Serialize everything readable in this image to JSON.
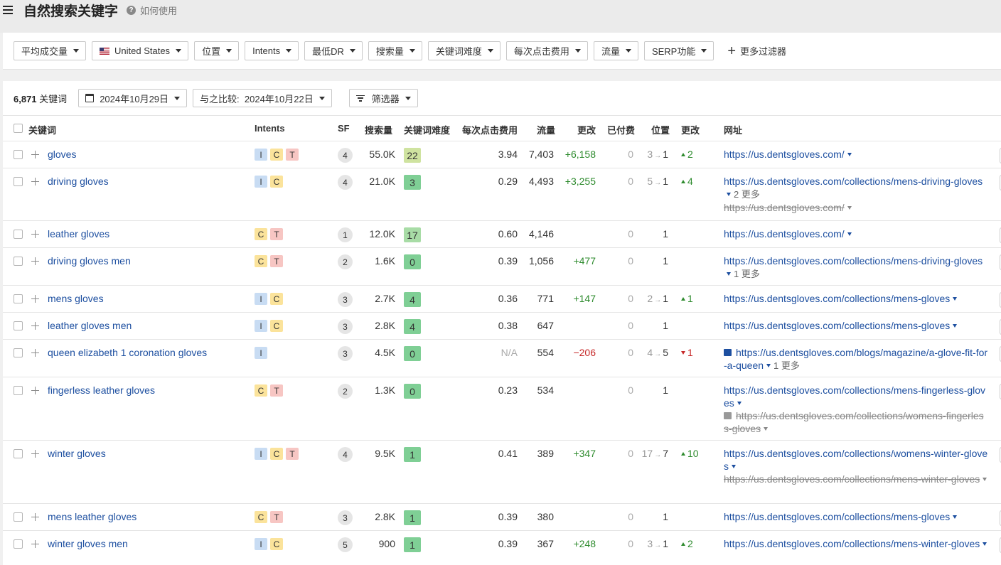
{
  "header": {
    "title": "自然搜索关键字",
    "help_label": "如何使用"
  },
  "filters": [
    "平均成交量",
    "United States",
    "位置",
    "Intents",
    "最低DR",
    "搜索量",
    "关键词难度",
    "每次点击费用",
    "流量",
    "SERP功能"
  ],
  "more_filters": "更多过滤器",
  "toolbar": {
    "count": "6,871",
    "count_label": "关键词",
    "date": "2024年10月29日",
    "compare_label": "与之比较:",
    "compare_date": "2024年10月22日",
    "filter_btn": "筛选器"
  },
  "columns": {
    "keyword": "关键词",
    "intents": "Intents",
    "sf": "SF",
    "volume": "搜索量",
    "kd": "关键词难度",
    "cpc": "每次点击费用",
    "traffic": "流量",
    "change": "更改",
    "paid": "已付费",
    "position": "位置",
    "pos_change": "更改",
    "url": "网址"
  },
  "rows": [
    {
      "keyword": "gloves",
      "intents": [
        "I",
        "C",
        "T"
      ],
      "sf": "4",
      "volume": "55.0K",
      "kd": "22",
      "kd_color": "#cfe3a0",
      "cpc": "3.94",
      "traffic": "7,403",
      "change": "+6,158",
      "paid": "0",
      "pos_from": "3",
      "pos_to": "1",
      "pos_change": "2",
      "pos_dir": "up",
      "url": "https://us.dentsgloves.com/",
      "url_more": "",
      "old_url": "",
      "url_image": false,
      "old_image": false
    },
    {
      "keyword": "driving gloves",
      "intents": [
        "I",
        "C"
      ],
      "sf": "4",
      "volume": "21.0K",
      "kd": "3",
      "kd_color": "#7fcf95",
      "cpc": "0.29",
      "traffic": "4,493",
      "change": "+3,255",
      "paid": "0",
      "pos_from": "5",
      "pos_to": "1",
      "pos_change": "4",
      "pos_dir": "up",
      "url": "https://us.dentsgloves.com/collections/mens-driving-gloves",
      "url_more": "2 更多",
      "old_url": "https://us.dentsgloves.com/",
      "url_image": false,
      "old_image": false
    },
    {
      "keyword": "leather gloves",
      "intents": [
        "C",
        "T"
      ],
      "sf": "1",
      "volume": "12.0K",
      "kd": "17",
      "kd_color": "#a8dca6",
      "cpc": "0.60",
      "traffic": "4,146",
      "change": "",
      "paid": "0",
      "pos_from": "",
      "pos_to": "1",
      "pos_change": "",
      "pos_dir": "",
      "url": "https://us.dentsgloves.com/",
      "url_more": "",
      "old_url": "",
      "url_image": false,
      "old_image": false
    },
    {
      "keyword": "driving gloves men",
      "intents": [
        "C",
        "T"
      ],
      "sf": "2",
      "volume": "1.6K",
      "kd": "0",
      "kd_color": "#7fcf95",
      "cpc": "0.39",
      "traffic": "1,056",
      "change": "+477",
      "paid": "0",
      "pos_from": "",
      "pos_to": "1",
      "pos_change": "",
      "pos_dir": "",
      "url": "https://us.dentsgloves.com/collections/mens-driving-gloves",
      "url_more": "1 更多",
      "old_url": "",
      "url_image": false,
      "old_image": false
    },
    {
      "keyword": "mens gloves",
      "intents": [
        "I",
        "C"
      ],
      "sf": "3",
      "volume": "2.7K",
      "kd": "4",
      "kd_color": "#7fcf95",
      "cpc": "0.36",
      "traffic": "771",
      "change": "+147",
      "paid": "0",
      "pos_from": "2",
      "pos_to": "1",
      "pos_change": "1",
      "pos_dir": "up",
      "url": "https://us.dentsgloves.com/collections/mens-gloves",
      "url_more": "",
      "old_url": "",
      "url_image": false,
      "old_image": false
    },
    {
      "keyword": "leather gloves men",
      "intents": [
        "I",
        "C"
      ],
      "sf": "3",
      "volume": "2.8K",
      "kd": "4",
      "kd_color": "#7fcf95",
      "cpc": "0.38",
      "traffic": "647",
      "change": "",
      "paid": "0",
      "pos_from": "",
      "pos_to": "1",
      "pos_change": "",
      "pos_dir": "",
      "url": "https://us.dentsgloves.com/collections/mens-gloves",
      "url_more": "",
      "old_url": "",
      "url_image": false,
      "old_image": false
    },
    {
      "keyword": "queen elizabeth 1 coronation gloves",
      "intents": [
        "I"
      ],
      "sf": "3",
      "volume": "4.5K",
      "kd": "0",
      "kd_color": "#7fcf95",
      "cpc": "N/A",
      "traffic": "554",
      "change": "−206",
      "paid": "0",
      "pos_from": "4",
      "pos_to": "5",
      "pos_change": "1",
      "pos_dir": "down",
      "url": "https://us.dentsgloves.com/blogs/magazine/a-glove-fit-for-a-queen",
      "url_more": "1 更多",
      "old_url": "",
      "url_image": true,
      "old_image": false
    },
    {
      "keyword": "fingerless leather gloves",
      "intents": [
        "C",
        "T"
      ],
      "sf": "2",
      "volume": "1.3K",
      "kd": "0",
      "kd_color": "#7fcf95",
      "cpc": "0.23",
      "traffic": "534",
      "change": "",
      "paid": "0",
      "pos_from": "",
      "pos_to": "1",
      "pos_change": "",
      "pos_dir": "",
      "url": "https://us.dentsgloves.com/collections/mens-fingerless-gloves",
      "url_more": "",
      "old_url": "https://us.dentsgloves.com/collections/womens-fingerless-gloves",
      "url_image": false,
      "old_image": true
    },
    {
      "keyword": "winter gloves",
      "intents": [
        "I",
        "C",
        "T"
      ],
      "sf": "4",
      "volume": "9.5K",
      "kd": "1",
      "kd_color": "#7fcf95",
      "cpc": "0.41",
      "traffic": "389",
      "change": "+347",
      "paid": "0",
      "pos_from": "17",
      "pos_to": "7",
      "pos_change": "10",
      "pos_dir": "up",
      "url": "https://us.dentsgloves.com/collections/womens-winter-gloves",
      "url_more": "",
      "old_url": "https://us.dentsgloves.com/collections/mens-winter-gloves",
      "url_image": false,
      "old_image": false
    },
    {
      "keyword": "mens leather gloves",
      "intents": [
        "C",
        "T"
      ],
      "sf": "3",
      "volume": "2.8K",
      "kd": "1",
      "kd_color": "#7fcf95",
      "cpc": "0.39",
      "traffic": "380",
      "change": "",
      "paid": "0",
      "pos_from": "",
      "pos_to": "1",
      "pos_change": "",
      "pos_dir": "",
      "url": "https://us.dentsgloves.com/collections/mens-gloves",
      "url_more": "",
      "old_url": "",
      "url_image": false,
      "old_image": false
    },
    {
      "keyword": "winter gloves men",
      "intents": [
        "I",
        "C"
      ],
      "sf": "5",
      "volume": "900",
      "kd": "1",
      "kd_color": "#7fcf95",
      "cpc": "0.39",
      "traffic": "367",
      "change": "+248",
      "paid": "0",
      "pos_from": "3",
      "pos_to": "1",
      "pos_change": "2",
      "pos_dir": "up",
      "url": "https://us.dentsgloves.com/collections/mens-winter-gloves",
      "url_more": "",
      "old_url": "",
      "url_image": false,
      "old_image": false
    }
  ]
}
